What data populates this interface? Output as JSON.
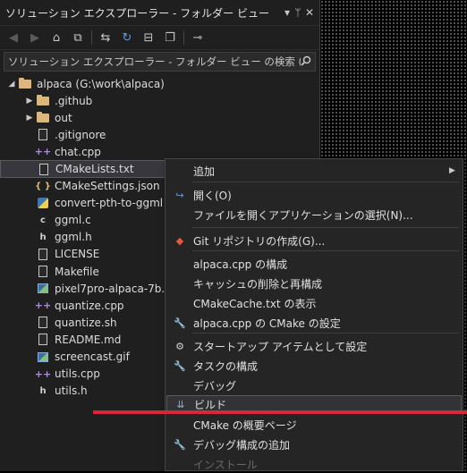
{
  "colors": {
    "accent": "#d9263a",
    "folder": "#dcb67a",
    "panel_bg": "#1f1f1f",
    "menu_bg": "#252526"
  },
  "window": {
    "title": "ソリューション エクスプローラー - フォルダー ビュー",
    "buttons": {
      "dropdown": "▾",
      "pin": "ᛘ",
      "close": "✕"
    }
  },
  "toolbar": {
    "icons": [
      "back-icon",
      "forward-icon",
      "home-icon",
      "switch-views-icon",
      "sync-icon",
      "refresh-icon",
      "collapse-all-icon",
      "show-all-files-icon",
      "properties-icon"
    ]
  },
  "search": {
    "placeholder": "ソリューション エクスプローラー - フォルダー ビュー の検索 (Ctrl+;)"
  },
  "tree": {
    "root": {
      "label": "alpaca (G:\\work\\alpaca)"
    },
    "items": [
      {
        "label": ".github",
        "type": "folder",
        "icon": "folder-icon",
        "expandable": true
      },
      {
        "label": "out",
        "type": "folder",
        "icon": "folder-icon",
        "expandable": true
      },
      {
        "label": ".gitignore",
        "type": "file",
        "icon": "file-icon"
      },
      {
        "label": "chat.cpp",
        "type": "cpp",
        "icon": "cpp-icon"
      },
      {
        "label": "CMakeLists.txt",
        "type": "file",
        "icon": "file-icon",
        "selected": true
      },
      {
        "label": "CMakeSettings.json",
        "type": "json",
        "icon": "json-icon"
      },
      {
        "label": "convert-pth-to-ggml",
        "type": "py",
        "icon": "python-icon"
      },
      {
        "label": "ggml.c",
        "type": "c",
        "icon": "c-file-icon"
      },
      {
        "label": "ggml.h",
        "type": "h",
        "icon": "header-file-icon"
      },
      {
        "label": "LICENSE",
        "type": "file",
        "icon": "file-icon"
      },
      {
        "label": "Makefile",
        "type": "file",
        "icon": "file-icon"
      },
      {
        "label": "pixel7pro-alpaca-7b.",
        "type": "img",
        "icon": "image-icon"
      },
      {
        "label": "quantize.cpp",
        "type": "cpp",
        "icon": "cpp-icon"
      },
      {
        "label": "quantize.sh",
        "type": "file",
        "icon": "file-icon"
      },
      {
        "label": "README.md",
        "type": "file",
        "icon": "markdown-icon"
      },
      {
        "label": "screencast.gif",
        "type": "img",
        "icon": "image-icon"
      },
      {
        "label": "utils.cpp",
        "type": "cpp",
        "icon": "cpp-icon"
      },
      {
        "label": "utils.h",
        "type": "h",
        "icon": "header-file-icon"
      }
    ]
  },
  "context_menu": {
    "items": [
      {
        "label": "追加",
        "icon": "",
        "submenu": true
      },
      {
        "label": "開く(O)",
        "icon": "open-arrow-icon"
      },
      {
        "label": "ファイルを開くアプリケーションの選択(N)...",
        "icon": ""
      },
      {
        "label": "Git リポジトリの作成(G)...",
        "icon": "git-icon"
      },
      {
        "label": "alpaca.cpp の構成",
        "icon": ""
      },
      {
        "label": "キャッシュの削除と再構成",
        "icon": ""
      },
      {
        "label": "CMakeCache.txt の表示",
        "icon": ""
      },
      {
        "label": "alpaca.cpp の CMake の設定",
        "icon": "wrench-icon"
      },
      {
        "label": "スタートアップ アイテムとして設定",
        "icon": "gear-icon"
      },
      {
        "label": "タスクの構成",
        "icon": "wrench-icon"
      },
      {
        "label": "デバッグ",
        "icon": ""
      },
      {
        "label": "ビルド",
        "icon": "build-icon",
        "hover": true
      },
      {
        "label": "CMake の概要ページ",
        "icon": ""
      },
      {
        "label": "デバッグ構成の追加",
        "icon": "wrench-icon"
      },
      {
        "label": "インストール",
        "icon": "",
        "disabled": true
      }
    ]
  }
}
